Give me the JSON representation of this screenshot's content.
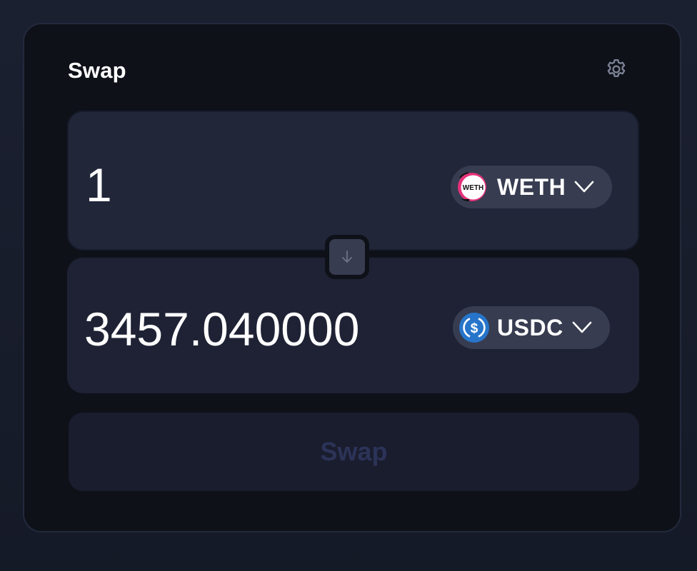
{
  "header": {
    "title": "Swap",
    "settings_icon": "gear-icon"
  },
  "from": {
    "amount": "1",
    "token": {
      "symbol": "WETH",
      "icon": "weth-token-icon",
      "icon_text": "WETH"
    }
  },
  "to": {
    "amount": "3457.040000",
    "token": {
      "symbol": "USDC",
      "icon": "usdc-token-icon",
      "icon_text": "$"
    }
  },
  "flip_icon": "arrow-down-icon",
  "swap_button": {
    "label": "Swap",
    "disabled": true
  },
  "colors": {
    "background": "#171c2a",
    "card": "#0e1118",
    "panel": "#212639",
    "token_pill": "#373c50",
    "usdc_blue": "#2775ca",
    "weth_pink": "#e4317a",
    "disabled_text": "#2c3358"
  }
}
